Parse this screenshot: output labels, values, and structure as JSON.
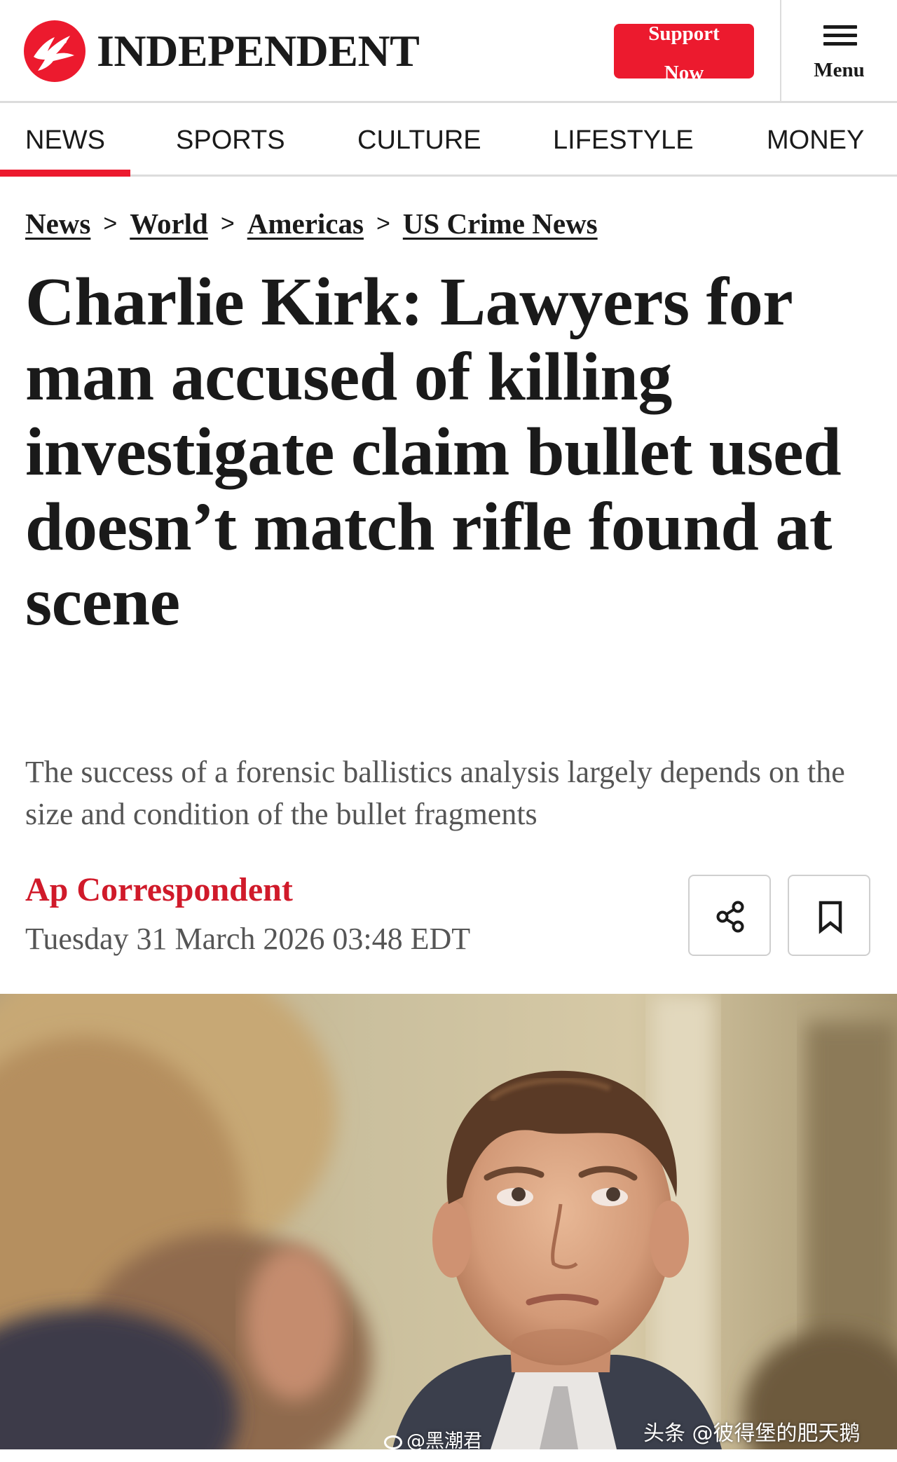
{
  "site": {
    "brand": "INDEPENDENT",
    "support_label": "Support Now",
    "menu_label": "Menu",
    "brand_color": "#ec1a2e"
  },
  "nav": {
    "items": [
      {
        "label": "NEWS",
        "active": true
      },
      {
        "label": "SPORTS",
        "active": false
      },
      {
        "label": "CULTURE",
        "active": false
      },
      {
        "label": "LIFESTYLE",
        "active": false
      },
      {
        "label": "MONEY",
        "active": false
      }
    ]
  },
  "breadcrumb": {
    "items": [
      "News",
      "World",
      "Americas",
      "US Crime News"
    ],
    "separator": ">"
  },
  "article": {
    "headline": "Charlie Kirk: Lawyers for man accused of killing investigate claim bullet used doesn’t match rifle found at scene",
    "standfirst": "The success of a forensic ballistics analysis largely depends on the size and condition of the bullet fragments",
    "author": "Ap Correspondent",
    "date": "Tuesday 31 March 2026 03:48 EDT",
    "author_color": "#d01a2a"
  },
  "actions": {
    "share_icon": "share-icon",
    "bookmark_icon": "bookmark-icon"
  },
  "watermarks": {
    "weibo": "@黑潮君",
    "toutiao": "头条 @彼得堡的肥天鹅"
  }
}
